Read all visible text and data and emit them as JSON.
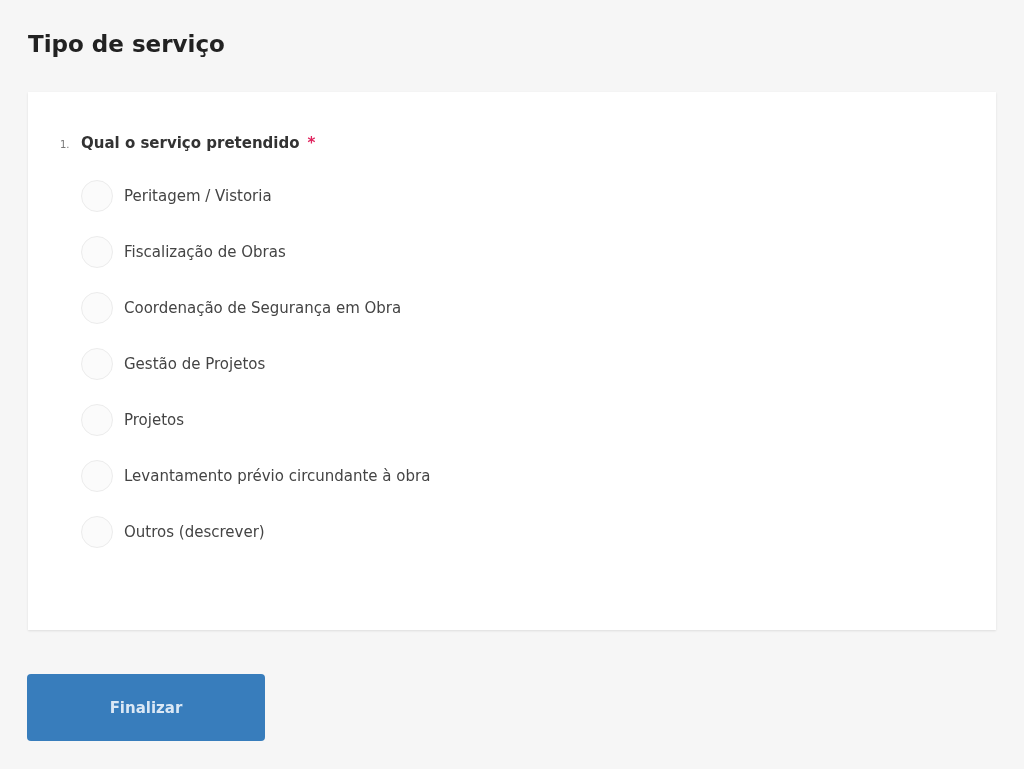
{
  "section_title": "Tipo de serviço",
  "question": {
    "number": "1.",
    "text": "Qual o serviço pretendido",
    "required_mark": "*",
    "options": [
      {
        "label": "Peritagem / Vistoria",
        "selected": false
      },
      {
        "label": "Fiscalização de Obras",
        "selected": false
      },
      {
        "label": "Coordenação de Segurança em Obra",
        "selected": false
      },
      {
        "label": "Gestão de Projetos",
        "selected": false
      },
      {
        "label": "Projetos",
        "selected": false
      },
      {
        "label": "Levantamento prévio circundante à obra",
        "selected": false
      },
      {
        "label": "Outros (descrever)",
        "selected": false
      }
    ]
  },
  "submit_button": "Finalizar"
}
